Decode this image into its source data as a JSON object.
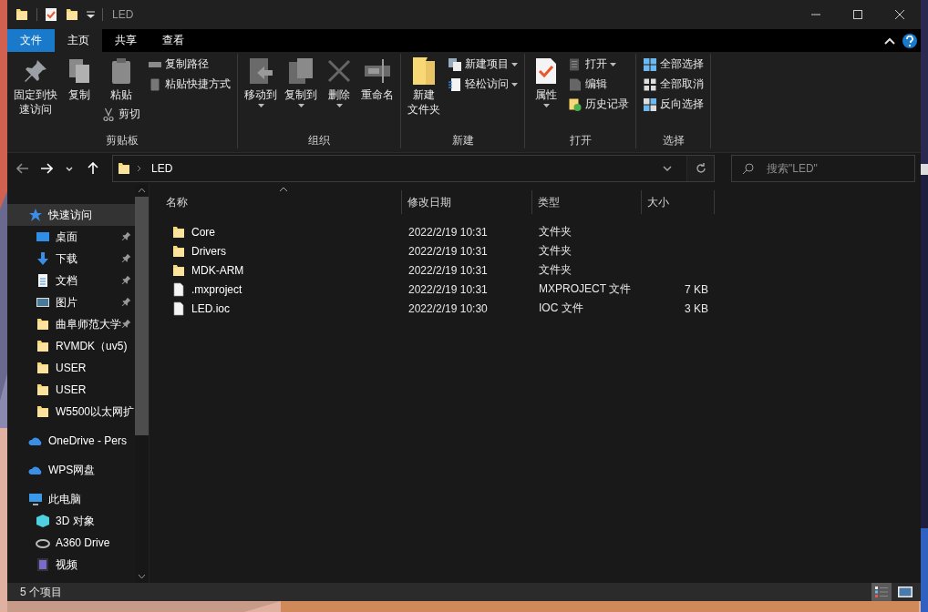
{
  "window": {
    "title": "LED"
  },
  "tabs": [
    {
      "label": "文件",
      "kind": "file",
      "selected": false
    },
    {
      "label": "主页",
      "kind": "tab",
      "selected": true
    },
    {
      "label": "共享",
      "kind": "tab",
      "selected": false
    },
    {
      "label": "查看",
      "kind": "tab",
      "selected": false
    }
  ],
  "ribbon": {
    "groups": [
      {
        "label": "剪贴板",
        "columns": [
          [
            {
              "label": [
                "固定到快",
                "速访问"
              ],
              "kind": "large",
              "dropdown": false
            }
          ],
          [
            {
              "label": [
                "复制"
              ],
              "kind": "large",
              "dropdown": false
            }
          ],
          [
            {
              "label": [
                "粘贴"
              ],
              "kind": "large",
              "dropdown": false
            },
            {
              "label": "剪切",
              "kind": "small",
              "dropdown": false
            }
          ],
          [
            {
              "label": "复制路径",
              "kind": "small",
              "dropdown": false
            },
            {
              "label": "粘贴快捷方式",
              "kind": "small",
              "dropdown": false
            }
          ]
        ]
      },
      {
        "label": "组织",
        "columns": [
          [
            {
              "label": [
                "移动到"
              ],
              "kind": "large",
              "dropdown": true
            }
          ],
          [
            {
              "label": [
                "复制到"
              ],
              "kind": "large",
              "dropdown": true
            }
          ],
          [
            {
              "label": [
                "删除"
              ],
              "kind": "large",
              "dropdown": true
            }
          ],
          [
            {
              "label": [
                "重命名"
              ],
              "kind": "large",
              "dropdown": false
            }
          ]
        ]
      },
      {
        "label": "新建",
        "columns": [
          [
            {
              "label": [
                "新建",
                "文件夹"
              ],
              "kind": "large",
              "dropdown": false
            }
          ],
          [
            {
              "label": "新建项目",
              "kind": "small",
              "dropdown": true
            },
            {
              "label": "轻松访问",
              "kind": "small",
              "dropdown": true
            }
          ]
        ]
      },
      {
        "label": "打开",
        "columns": [
          [
            {
              "label": [
                "属性"
              ],
              "kind": "large",
              "dropdown": true
            }
          ],
          [
            {
              "label": "打开",
              "kind": "small",
              "dropdown": true
            },
            {
              "label": "编辑",
              "kind": "small",
              "dropdown": false
            },
            {
              "label": "历史记录",
              "kind": "small",
              "dropdown": false
            }
          ]
        ]
      },
      {
        "label": "选择",
        "columns": [
          [
            {
              "label": "全部选择",
              "kind": "small",
              "dropdown": false
            },
            {
              "label": "全部取消",
              "kind": "small",
              "dropdown": false
            },
            {
              "label": "反向选择",
              "kind": "small",
              "dropdown": false
            }
          ]
        ]
      }
    ]
  },
  "address": {
    "path": [
      "LED"
    ],
    "search_placeholder": "搜索\"LED\""
  },
  "sidebar": {
    "sections": [
      {
        "label": "快速访问",
        "selected": true,
        "children": [
          {
            "label": "桌面",
            "pinned": true
          },
          {
            "label": "下载",
            "pinned": true
          },
          {
            "label": "文档",
            "pinned": true
          },
          {
            "label": "图片",
            "pinned": true
          },
          {
            "label": "曲阜师范大学",
            "pinned": true
          },
          {
            "label": "RVMDK（uv5)",
            "pinned": false
          },
          {
            "label": "USER",
            "pinned": false
          },
          {
            "label": "USER",
            "pinned": false
          },
          {
            "label": "W5500以太网扩",
            "pinned": false
          }
        ]
      },
      {
        "label": "OneDrive - Pers",
        "selected": false
      },
      {
        "label": "WPS网盘",
        "selected": false
      },
      {
        "label": "此电脑",
        "selected": false,
        "children": [
          {
            "label": "3D 对象",
            "pinned": false
          },
          {
            "label": "A360 Drive",
            "pinned": false
          },
          {
            "label": "视频",
            "pinned": false
          }
        ]
      }
    ]
  },
  "table": {
    "columns": [
      "名称",
      "修改日期",
      "类型",
      "大小"
    ],
    "rows": [
      {
        "name": "Core",
        "modified": "2022/2/19 10:31",
        "type": "文件夹",
        "kind": "folder"
      },
      {
        "name": "Drivers",
        "modified": "2022/2/19 10:31",
        "type": "文件夹",
        "kind": "folder"
      },
      {
        "name": "MDK-ARM",
        "modified": "2022/2/19 10:31",
        "type": "文件夹",
        "kind": "folder"
      },
      {
        "name": ".mxproject",
        "modified": "2022/2/19 10:31",
        "type": "MXPROJECT 文件",
        "size": "7 KB",
        "kind": "file"
      },
      {
        "name": "LED.ioc",
        "modified": "2022/2/19 10:30",
        "type": "IOC 文件",
        "size": "3 KB",
        "kind": "file"
      }
    ]
  },
  "status_bar": {
    "text": "5 个项目",
    "views": [
      {
        "kind": "details",
        "selected": true
      },
      {
        "kind": "large-icons",
        "selected": false
      }
    ]
  }
}
